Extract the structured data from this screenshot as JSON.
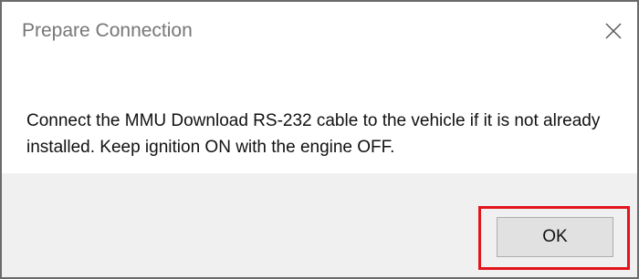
{
  "window": {
    "title": "Prepare Connection",
    "close_icon": "close-icon"
  },
  "message": {
    "text": "Connect the MMU Download RS-232 cable to the vehicle if it is not already installed.  Keep ignition ON with the engine OFF."
  },
  "footer": {
    "ok_label": "OK",
    "highlight_color": "#e3141b"
  }
}
